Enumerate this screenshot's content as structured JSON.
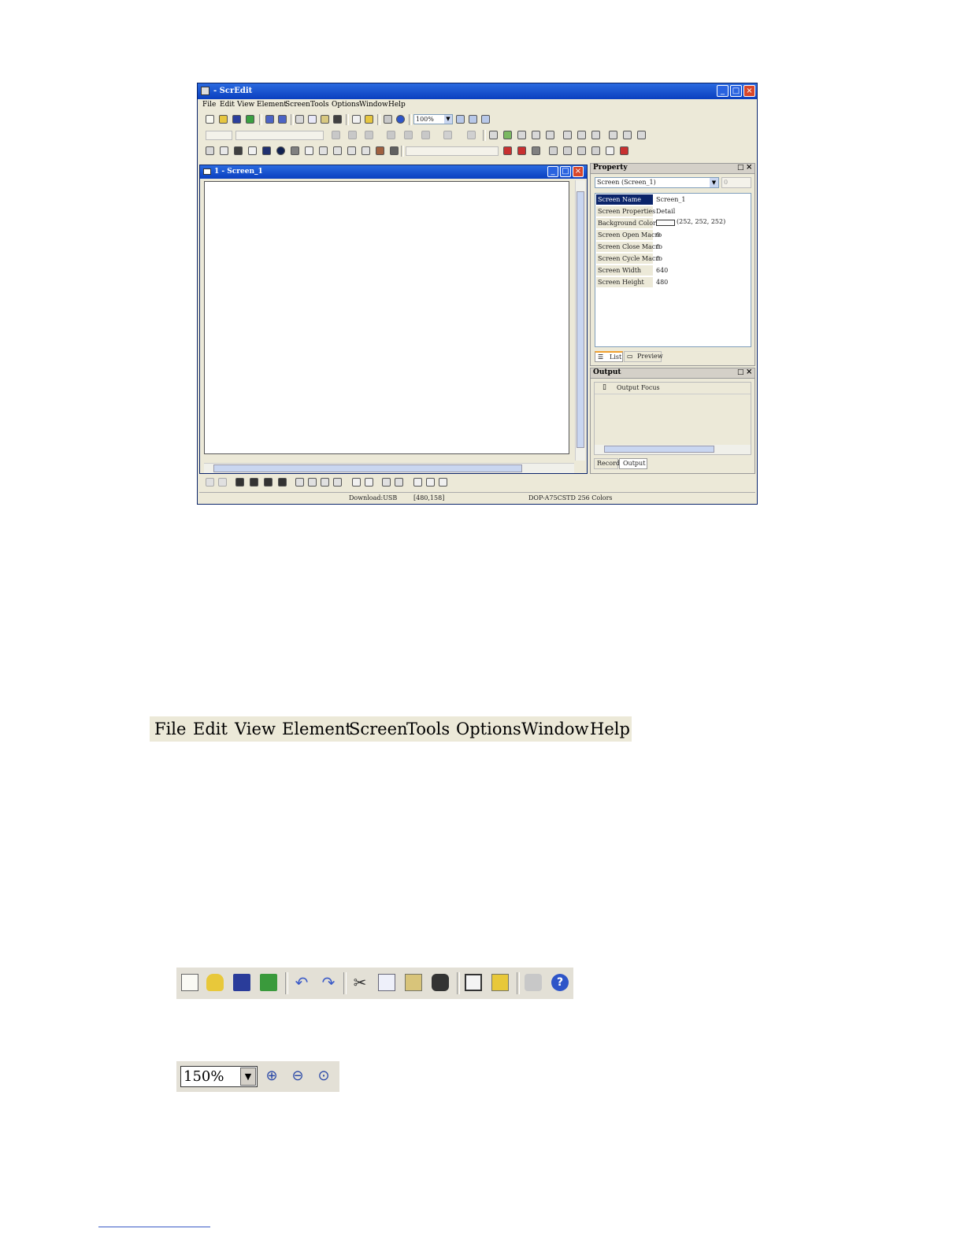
{
  "app": {
    "title": "- ScrEdit",
    "menu": [
      "File",
      "Edit",
      "View",
      "Element",
      "Screen",
      "Tools",
      "Options",
      "Window",
      "Help"
    ],
    "zoom": "100%",
    "screen_window_title": "1 - Screen_1",
    "property_panel": {
      "title": "Property",
      "selector": "Screen (Screen_1)",
      "spin_value": "0",
      "rows": [
        {
          "name": "Screen Name",
          "value": "Screen_1"
        },
        {
          "name": "Screen Properties",
          "value": "Detail"
        },
        {
          "name": "Background Color",
          "value": "(252, 252, 252)"
        },
        {
          "name": "Screen Open Macro",
          "value": "0"
        },
        {
          "name": "Screen Close Macro",
          "value": "0"
        },
        {
          "name": "Screen Cycle Macro",
          "value": "0"
        },
        {
          "name": "Screen Width",
          "value": "640"
        },
        {
          "name": "Screen Height",
          "value": "480"
        }
      ],
      "tabs": [
        "List",
        "Preview"
      ]
    },
    "output_panel": {
      "title": "Output",
      "item": "Output Focus",
      "tabs": [
        "Record",
        "Output"
      ]
    },
    "status": {
      "download": "Download:USB",
      "coords": "[480,158]",
      "model": "DOP-A75CSTD 256 Colors"
    }
  },
  "menu_strip": [
    "File",
    "Edit",
    "View",
    "Element",
    "Screen",
    "Tools",
    "Options",
    "Window",
    "Help"
  ],
  "zoom_strip": {
    "value": "150%"
  },
  "colors": {
    "title_blue": "#0a3fbf",
    "chrome": "#ece9d8",
    "selection": "#0a246a"
  }
}
